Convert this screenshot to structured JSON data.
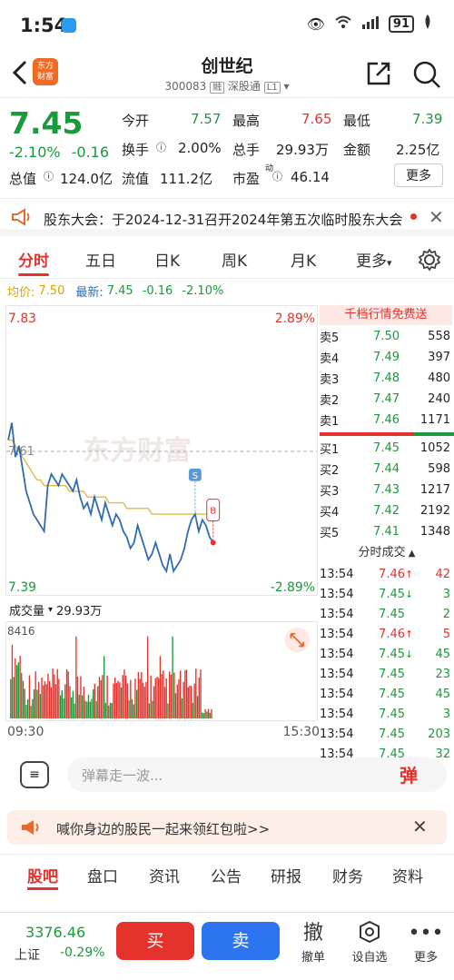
{
  "status": {
    "time": "1:54",
    "battery": "91"
  },
  "header": {
    "title": "创世纪",
    "code": "300083",
    "tag1": "融",
    "market": "深股通",
    "level": "L1",
    "logo_line1": "东方",
    "logo_line2": "财富"
  },
  "quote": {
    "price": "7.45",
    "change_pct": "-2.10%",
    "change": "-0.16",
    "open_label": "今开",
    "open": "7.57",
    "high_label": "最高",
    "high": "7.65",
    "low_label": "最低",
    "low": "7.39",
    "turnover_label": "换手",
    "turnover": "2.00%",
    "volume_label": "总手",
    "volume": "29.93万",
    "amount_label": "金额",
    "amount": "2.25亿",
    "mcap_label": "总值",
    "mcap": "124.0亿",
    "float_label": "流值",
    "float": "111.2亿",
    "pe_label": "市盈",
    "pe_sup": "动",
    "pe": "46.14",
    "more": "更多"
  },
  "notice": {
    "text": "股东大会：于2024-12-31召开2024年第五次临时股东大会"
  },
  "tabs": [
    "分时",
    "五日",
    "日K",
    "周K",
    "月K",
    "更多"
  ],
  "chart_info": {
    "avg_label": "均价:",
    "avg": "7.50",
    "last_label": "最新:",
    "last": "7.45",
    "chg": "-0.16",
    "pct": "-2.10%"
  },
  "chart_axes": {
    "y_top": "7.83",
    "y_top_pct": "2.89%",
    "y_bottom": "7.39",
    "y_bottom_pct": "-2.89%",
    "y_mid": "7.61",
    "watermark": "东方财富",
    "marker_s": "S",
    "marker_b": "B"
  },
  "chart_data": {
    "type": "line",
    "title": "",
    "ylim": [
      7.39,
      7.83
    ],
    "prev_close": 7.61,
    "series": [
      {
        "name": "最新",
        "values": [
          7.63,
          7.66,
          7.6,
          7.62,
          7.58,
          7.54,
          7.52,
          7.5,
          7.49,
          7.48,
          7.47,
          7.55,
          7.57,
          7.56,
          7.55,
          7.57,
          7.56,
          7.55,
          7.54,
          7.56,
          7.53,
          7.51,
          7.52,
          7.5,
          7.53,
          7.51,
          7.49,
          7.52,
          7.5,
          7.48,
          7.5,
          7.49,
          7.47,
          7.46,
          7.44,
          7.45,
          7.48,
          7.46,
          7.44,
          7.42,
          7.43,
          7.45,
          7.43,
          7.41,
          7.4,
          7.43,
          7.4,
          7.41,
          7.42,
          7.44,
          7.47,
          7.49,
          7.5,
          7.47,
          7.49,
          7.48,
          7.46,
          7.45
        ]
      },
      {
        "name": "均价",
        "values": [
          7.63,
          7.63,
          7.62,
          7.61,
          7.6,
          7.59,
          7.58,
          7.57,
          7.56,
          7.56,
          7.55,
          7.55,
          7.55,
          7.55,
          7.55,
          7.55,
          7.55,
          7.54,
          7.54,
          7.54,
          7.54,
          7.54,
          7.53,
          7.53,
          7.53,
          7.53,
          7.53,
          7.53,
          7.52,
          7.52,
          7.52,
          7.52,
          7.52,
          7.51,
          7.51,
          7.51,
          7.51,
          7.51,
          7.51,
          7.51,
          7.5,
          7.5,
          7.5,
          7.5,
          7.5,
          7.5,
          7.5,
          7.5,
          7.5,
          7.5,
          7.5,
          7.5,
          7.5,
          7.5,
          7.5,
          7.5,
          7.5,
          7.5
        ]
      }
    ],
    "volume": {
      "label": "成交量",
      "total": "29.93万",
      "max": "8416"
    },
    "xlabels": [
      "09:30",
      "15:30"
    ]
  },
  "orderbook": {
    "banner": "千档行情免费送",
    "sells": [
      {
        "label": "卖5",
        "price": "7.50",
        "vol": "558"
      },
      {
        "label": "卖4",
        "price": "7.49",
        "vol": "397"
      },
      {
        "label": "卖3",
        "price": "7.48",
        "vol": "480"
      },
      {
        "label": "卖2",
        "price": "7.47",
        "vol": "240"
      },
      {
        "label": "卖1",
        "price": "7.46",
        "vol": "1171"
      }
    ],
    "buys": [
      {
        "label": "买1",
        "price": "7.45",
        "vol": "1052"
      },
      {
        "label": "买2",
        "price": "7.44",
        "vol": "598"
      },
      {
        "label": "买3",
        "price": "7.43",
        "vol": "1217"
      },
      {
        "label": "买4",
        "price": "7.42",
        "vol": "2192"
      },
      {
        "label": "买5",
        "price": "7.41",
        "vol": "1348"
      }
    ],
    "trades_title": "分时成交",
    "trades": [
      {
        "t": "13:54",
        "p": "7.46",
        "d": "↑",
        "v": "42",
        "pc": "red",
        "vc": "red"
      },
      {
        "t": "13:54",
        "p": "7.45",
        "d": "↓",
        "v": "3",
        "pc": "green",
        "vc": "green"
      },
      {
        "t": "13:54",
        "p": "7.45",
        "d": "",
        "v": "2",
        "pc": "green",
        "vc": "green"
      },
      {
        "t": "13:54",
        "p": "7.46",
        "d": "↑",
        "v": "5",
        "pc": "red",
        "vc": "red"
      },
      {
        "t": "13:54",
        "p": "7.45",
        "d": "↓",
        "v": "45",
        "pc": "green",
        "vc": "green"
      },
      {
        "t": "13:54",
        "p": "7.45",
        "d": "",
        "v": "23",
        "pc": "green",
        "vc": "green"
      },
      {
        "t": "13:54",
        "p": "7.45",
        "d": "",
        "v": "45",
        "pc": "green",
        "vc": "green"
      },
      {
        "t": "13:54",
        "p": "7.45",
        "d": "",
        "v": "3",
        "pc": "green",
        "vc": "green"
      },
      {
        "t": "13:54",
        "p": "7.45",
        "d": "",
        "v": "203",
        "pc": "green",
        "vc": "green"
      },
      {
        "t": "13:54",
        "p": "7.45",
        "d": "",
        "v": "32",
        "pc": "green",
        "vc": "green"
      }
    ]
  },
  "danmu": {
    "placeholder": "弹幕走一波...",
    "btn": "弹"
  },
  "promo": {
    "text": "喊你身边的股民一起来领红包啦>>"
  },
  "bottom_tabs": [
    "股吧",
    "盘口",
    "资讯",
    "公告",
    "研报",
    "财务",
    "资料"
  ],
  "footer": {
    "index_val": "3376.46",
    "index_name": "上证",
    "index_chg": "-0.29%",
    "buy": "买",
    "sell": "卖",
    "cancel": "撤单",
    "watch": "设自选",
    "more": "更多",
    "cancel_glyph": "撤"
  }
}
